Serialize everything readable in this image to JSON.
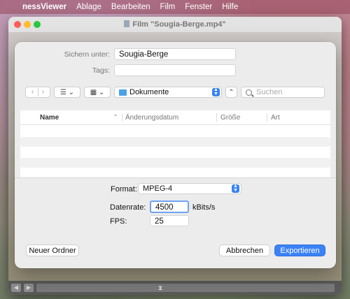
{
  "menubar": {
    "app_name": "nessViewer",
    "items": [
      "Ablage",
      "Bearbeiten",
      "Film",
      "Fenster",
      "Hilfe"
    ]
  },
  "window": {
    "title": "Film \"Sougia-Berge.mp4\""
  },
  "save_sheet": {
    "save_as_label": "Sichern unter:",
    "save_as_value": "Sougia-Berge",
    "tags_label": "Tags:",
    "tags_value": "",
    "location": "Dokumente",
    "search_placeholder": "Suchen",
    "columns": [
      "Name",
      "Änderungsdatum",
      "Größe",
      "Art"
    ]
  },
  "options": {
    "format_label": "Format:",
    "format_value": "MPEG-4",
    "datarate_label": "Datenrate:",
    "datarate_value": "4500",
    "datarate_unit": "kBits/s",
    "fps_label": "FPS:",
    "fps_value": "25"
  },
  "buttons": {
    "new_folder": "Neuer Ordner",
    "cancel": "Abbrechen",
    "export": "Exportieren"
  },
  "colors": {
    "accent": "#3b82f6",
    "folder": "#4aa3e6"
  }
}
